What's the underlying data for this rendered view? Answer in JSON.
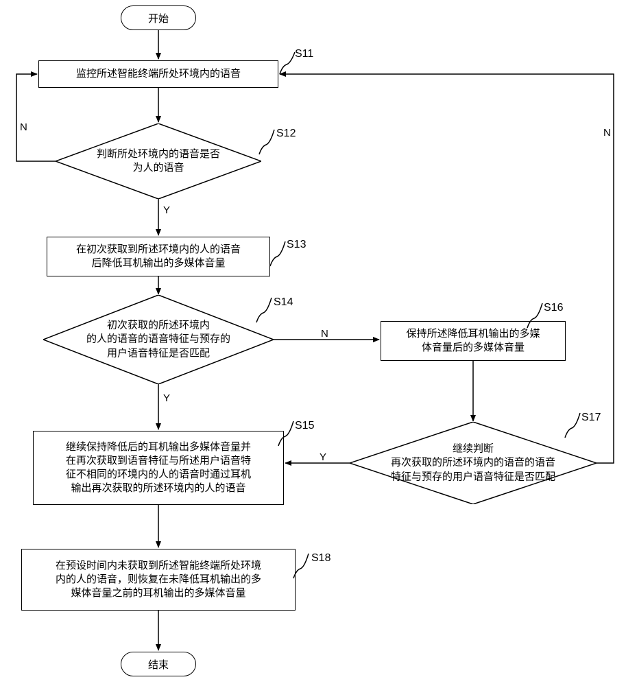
{
  "flow": {
    "start_label": "开始",
    "end_label": "结束",
    "s11": {
      "ref": "S11",
      "text": "监控所述智能终端所处环境内的语音"
    },
    "s12": {
      "ref": "S12",
      "text": "判断所处环境内的语音是否\n为人的语音"
    },
    "s13": {
      "ref": "S13",
      "text": "在初次获取到所述环境内的人的语音\n后降低耳机输出的多媒体音量"
    },
    "s14": {
      "ref": "S14",
      "text": "初次获取的所述环境内\n的人的语音的语音特征与预存的\n用户语音特征是否匹配"
    },
    "s15": {
      "ref": "S15",
      "text": "继续保持降低后的耳机输出多媒体音量并\n在再次获取到语音特征与所述用户语音特\n征不相同的环境内的人的语音时通过耳机\n输出再次获取的所述环境内的人的语音"
    },
    "s16": {
      "ref": "S16",
      "text": "保持所述降低耳机输出的多媒\n体音量后的多媒体音量"
    },
    "s17": {
      "ref": "S17",
      "text": "继续判断\n再次获取的所述环境内的语音的语音\n特征与预存的用户语音特征是否匹配"
    },
    "s18": {
      "ref": "S18",
      "text": "在预设时间内未获取到所述智能终端所处环境\n内的人的语音，则恢复在未降低耳机输出的多\n媒体音量之前的耳机输出的多媒体音量"
    },
    "yes_label": "Y",
    "no_label": "N"
  }
}
